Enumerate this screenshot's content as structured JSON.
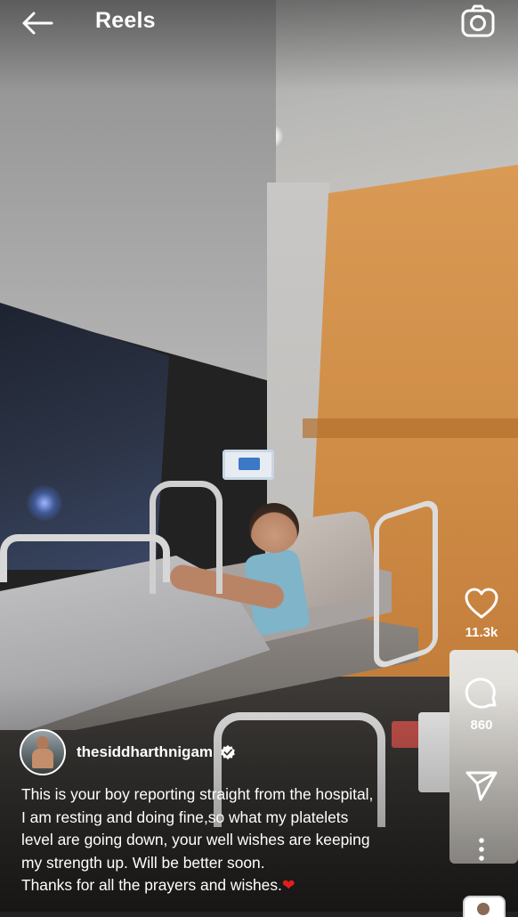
{
  "header": {
    "title": "Reels",
    "back_icon": "arrow-left-icon",
    "camera_icon": "camera-icon"
  },
  "actions": {
    "like": {
      "icon": "heart-outline-icon",
      "count": "11.3k"
    },
    "comment": {
      "icon": "comment-bubble-icon",
      "count": "860"
    },
    "share": {
      "icon": "send-paper-plane-icon"
    },
    "more": {
      "icon": "more-vertical-icon"
    }
  },
  "post": {
    "username": "thesiddharthnigam",
    "verified": true,
    "caption_lines": [
      "This is your boy reporting straight from the hospital,",
      "I am resting and doing fine,so what  my platelets",
      "level are going down, your well wishes are keeping",
      "my strength up. Will be better soon.",
      "Thanks for all the prayers and wishes."
    ],
    "caption_emoji": "❤"
  },
  "colors": {
    "text": "#ffffff",
    "emoji_heart": "#e0201c",
    "orange_wall": "#cf8d47"
  }
}
